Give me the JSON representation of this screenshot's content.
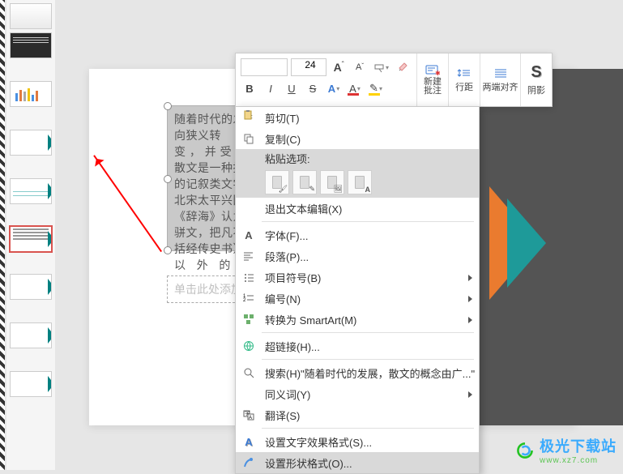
{
  "toolbar": {
    "font_size": "24",
    "bold": "B",
    "italic": "I",
    "underline": "U",
    "strike": "S",
    "font_color_letter": "A",
    "highlight_letter": "A",
    "font_increase": "A",
    "font_decrease": "A",
    "brush": "✎",
    "new_comment": "新建\n批注",
    "line_spacing": "行距",
    "justify": "两端对齐",
    "shadow": "阴影",
    "shadow_letter": "S"
  },
  "slide": {
    "text_content": "随着时代的发展，散文的概念由广义向狭义转\n变 ， 并 受 到\n散文是一种抒发\n的记叙类文学体\n北宋太平兴国（\n《辞海》认为：\n骈文，把凡不押\n括经传史书），\n以   外   的",
    "subtitle_placeholder": "单击此处添加副"
  },
  "context_menu": {
    "cut": "剪切(T)",
    "copy": "复制(C)",
    "paste_label": "粘贴选项:",
    "exit_text_edit": "退出文本编辑(X)",
    "font": "字体(F)...",
    "paragraph": "段落(P)...",
    "bullets": "项目符号(B)",
    "numbering": "编号(N)",
    "convert_smartart": "转换为 SmartArt(M)",
    "hyperlink": "超链接(H)...",
    "search": "搜索(H)\"随着时代的发展，散文的概念由广...\"",
    "synonym": "同义词(Y)",
    "translate": "翻译(S)",
    "text_effects": "设置文字效果格式(S)...",
    "shape_format": "设置形状格式(O)..."
  },
  "watermark": {
    "text": "极光下载站",
    "url": "www.xz7.com"
  }
}
